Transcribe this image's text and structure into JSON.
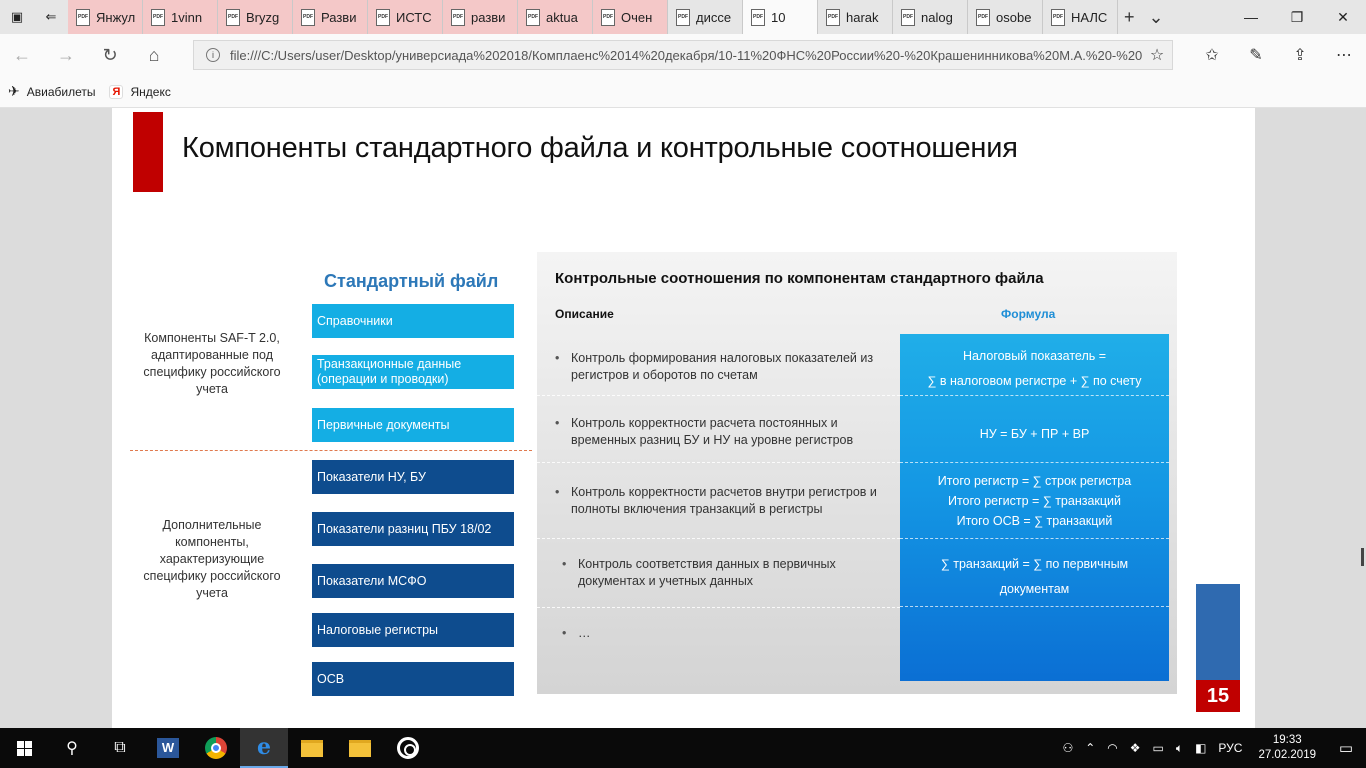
{
  "browser": {
    "tabs": [
      {
        "label": "Янжул",
        "tint": "pink"
      },
      {
        "label": "1vinn",
        "tint": "pink"
      },
      {
        "label": "Bryzg",
        "tint": "pink"
      },
      {
        "label": "Разви",
        "tint": "pink"
      },
      {
        "label": "ИСТС",
        "tint": "pink"
      },
      {
        "label": "разви",
        "tint": "pink"
      },
      {
        "label": "aktua",
        "tint": "pink"
      },
      {
        "label": "Очен",
        "tint": "pink"
      },
      {
        "label": "диссе",
        "tint": "none"
      },
      {
        "label": "10",
        "tint": "active"
      },
      {
        "label": "harak",
        "tint": "none"
      },
      {
        "label": "nalog",
        "tint": "none"
      },
      {
        "label": "osobe",
        "tint": "none"
      },
      {
        "label": "НАЛС",
        "tint": "none"
      }
    ],
    "address": "file:///C:/Users/user/Desktop/универсиада%202018/Комплаенс%2014%20декабря/10-11%20ФНС%20России%20-%20Крашенинникова%20М.А.%20-%20",
    "favorites": [
      {
        "label": "Авиабилеты",
        "icon": "airplane-icon"
      },
      {
        "label": "Яндекс",
        "icon": "yandex-icon"
      }
    ]
  },
  "slide": {
    "title": "Компоненты стандартного файла и контрольные соотношения",
    "standard_file_title": "Стандартный файл",
    "components_top": [
      "Справочники",
      "Транзакционные данные (операции и проводки)",
      "Первичные документы"
    ],
    "components_bottom": [
      "Показатели НУ, БУ",
      "Показатели разниц ПБУ 18/02",
      "Показатели МСФО",
      "Налоговые регистры",
      "ОСВ"
    ],
    "label_top": "Компоненты SAF-T 2.0, адаптированные под специфику российского учета",
    "label_bottom": "Дополнительные компоненты, характеризующие специфику российского учета",
    "ratios_title": "Контрольные соотношения по компонентам стандартного файла",
    "col_description": "Описание",
    "col_formula": "Формула",
    "descriptions": [
      "Контроль формирования налоговых показателей из регистров и оборотов по счетам",
      "Контроль корректности расчета постоянных и временных разниц БУ и НУ на уровне регистров",
      "Контроль корректности расчетов внутри регистров и полноты включения транзакций в регистры",
      "Контроль соответствия данных в первичных документах и учетных данных",
      "…"
    ],
    "formulas": [
      [
        "Налоговый показатель =",
        "∑ в налоговом регистре + ∑ по счету"
      ],
      [
        "НУ = БУ + ПР + ВР"
      ],
      [
        "Итого регистр = ∑ строк регистра",
        "Итого регистр = ∑ транзакций",
        "Итого ОСВ = ∑ транзакций"
      ],
      [
        "∑ транзакций = ∑ по первичным",
        "документам"
      ]
    ],
    "page_number": "15"
  },
  "taskbar": {
    "language": "РУС",
    "time": "19:33",
    "date": "27.02.2019"
  }
}
